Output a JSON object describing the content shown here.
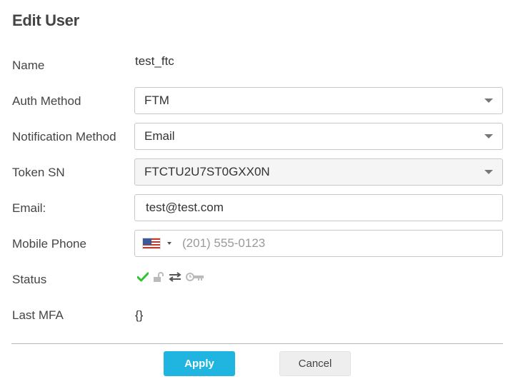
{
  "dialog": {
    "title": "Edit User"
  },
  "fields": {
    "name": {
      "label": "Name",
      "value": "test_ftc"
    },
    "auth_method": {
      "label": "Auth Method",
      "value": "FTM"
    },
    "notification_method": {
      "label": "Notification Method",
      "value": "Email"
    },
    "token_sn": {
      "label": "Token SN",
      "value": "FTCTU2U7ST0GXX0N"
    },
    "email": {
      "label": "Email:",
      "value": "test@test.com"
    },
    "mobile_phone": {
      "label": "Mobile Phone",
      "country": "US",
      "placeholder": "(201) 555-0123"
    },
    "status": {
      "label": "Status",
      "icons": [
        "check-icon",
        "unlock-icon",
        "transfer-icon",
        "token-key-icon"
      ],
      "colors": {
        "check": "#2ec42e",
        "muted": "#bbbbbb",
        "dark": "#555555"
      }
    },
    "last_mfa": {
      "label": "Last MFA",
      "value": "{}"
    }
  },
  "actions": {
    "apply_label": "Apply",
    "cancel_label": "Cancel"
  },
  "colors": {
    "accent": "#1fb5e0",
    "border": "#c8c8c8"
  }
}
